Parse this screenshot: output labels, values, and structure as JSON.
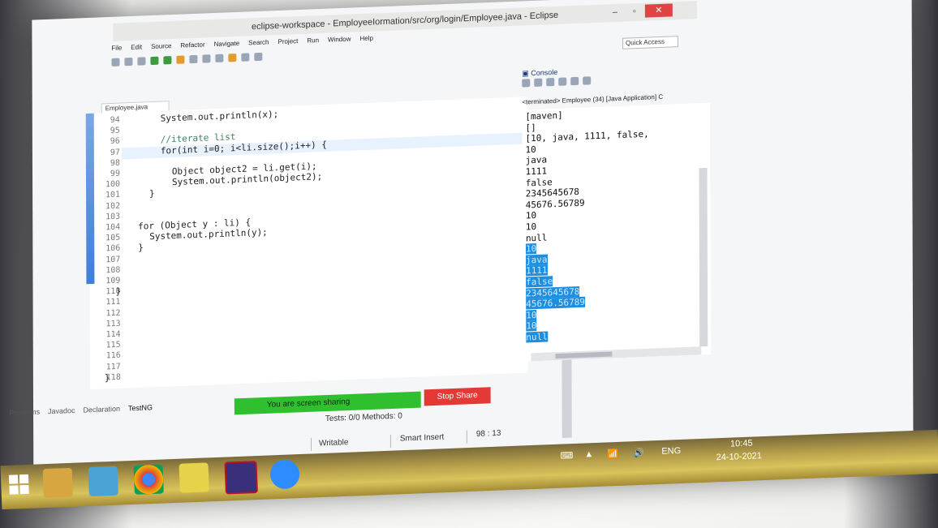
{
  "window": {
    "title": "eclipse-workspace - EmployeeIormation/src/org/login/Employee.java - Eclipse",
    "buttons": {
      "minimize": "–",
      "maximize": "▫",
      "close": "✕"
    }
  },
  "menu": [
    "File",
    "Edit",
    "Source",
    "Refactor",
    "Navigate",
    "Search",
    "Project",
    "Run",
    "Window",
    "Help"
  ],
  "toolbar": {
    "quick_access": "Quick Access"
  },
  "editor": {
    "tab_label": "Employee.java",
    "lines": [
      {
        "n": "94",
        "code": "System.out.println(x);"
      },
      {
        "n": "95",
        "code": ""
      },
      {
        "n": "96",
        "code": "//iterate list"
      },
      {
        "n": "97",
        "code": "for(int i=0; i<li.size();i++) {"
      },
      {
        "n": "98",
        "code": ""
      },
      {
        "n": "99",
        "code": "Object object2 = li.get(i);"
      },
      {
        "n": "100",
        "code": "System.out.println(object2);"
      },
      {
        "n": "101",
        "code": "}"
      },
      {
        "n": "102",
        "code": ""
      },
      {
        "n": "103",
        "code": ""
      },
      {
        "n": "104",
        "code": "for (Object y : li) {"
      },
      {
        "n": "105",
        "code": "System.out.println(y);"
      },
      {
        "n": "106",
        "code": "}"
      },
      {
        "n": "107",
        "code": ""
      },
      {
        "n": "108",
        "code": ""
      },
      {
        "n": "109",
        "code": ""
      },
      {
        "n": "110",
        "code": "}"
      },
      {
        "n": "111",
        "code": ""
      },
      {
        "n": "112",
        "code": ""
      },
      {
        "n": "113",
        "code": ""
      },
      {
        "n": "114",
        "code": ""
      },
      {
        "n": "115",
        "code": ""
      },
      {
        "n": "116",
        "code": ""
      },
      {
        "n": "117",
        "code": ""
      },
      {
        "n": "118",
        "code": "}"
      }
    ]
  },
  "console": {
    "title": "Console",
    "status": "<terminated> Employee (34) [Java Application] C",
    "lines": [
      {
        "text": "[maven]",
        "hl": false
      },
      {
        "text": "[]",
        "hl": false
      },
      {
        "text": "[10, java, 1111, false,",
        "hl": false
      },
      {
        "text": "10",
        "hl": false
      },
      {
        "text": "java",
        "hl": false
      },
      {
        "text": "1111",
        "hl": false
      },
      {
        "text": "false",
        "hl": false
      },
      {
        "text": "2345645678",
        "hl": false
      },
      {
        "text": "45676.56789",
        "hl": false
      },
      {
        "text": "10",
        "hl": false
      },
      {
        "text": "10",
        "hl": false
      },
      {
        "text": "null",
        "hl": false
      },
      {
        "text": "10",
        "hl": true
      },
      {
        "text": "java",
        "hl": true
      },
      {
        "text": "1111",
        "hl": true
      },
      {
        "text": "false",
        "hl": true
      },
      {
        "text": "2345645678",
        "hl": true
      },
      {
        "text": "45676.56789",
        "hl": true
      },
      {
        "text": "10",
        "hl": true
      },
      {
        "text": "10",
        "hl": true
      },
      {
        "text": "null",
        "hl": true
      }
    ]
  },
  "bottom_tabs": [
    "Problems",
    "Javadoc",
    "Declaration",
    "TestNG"
  ],
  "share": {
    "label": "You are screen sharing",
    "stop": "Stop Share"
  },
  "tests": "Tests: 0/0  Methods: 0",
  "status": {
    "writable": "Writable",
    "insert": "Smart Insert",
    "position": "98 : 13"
  },
  "taskbar": {
    "apps": [
      "explorer",
      "notes",
      "chrome",
      "sticky-notes",
      "java-ee",
      "zoom"
    ],
    "lang": "ENG",
    "time": "10:45",
    "date": "24-10-2021"
  },
  "colors": {
    "highlight": "#1e8fe0",
    "share_green": "#2fbf2f",
    "stop_red": "#e53935"
  }
}
